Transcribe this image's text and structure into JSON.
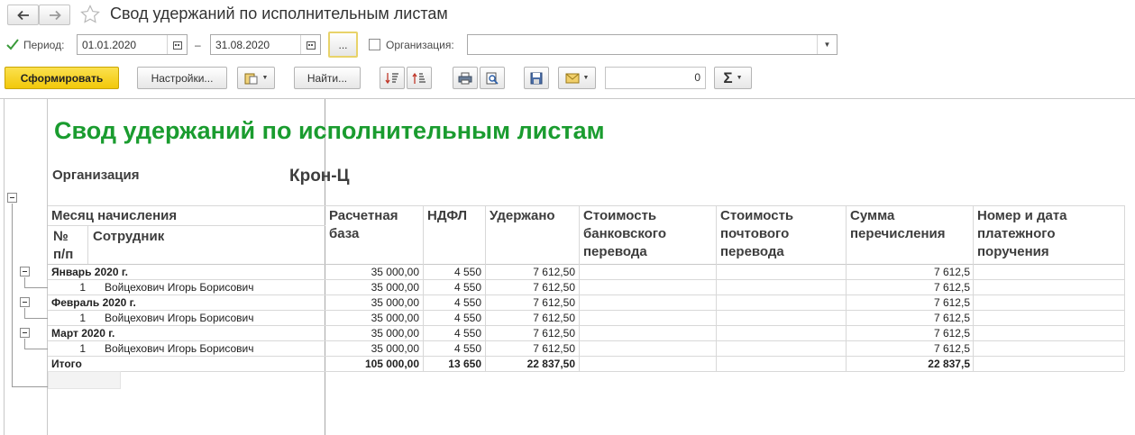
{
  "window": {
    "title": "Свод удержаний по исполнительным листам",
    "back_icon": "arrow-left-icon",
    "forward_icon": "arrow-right-icon",
    "favorite_icon": "star-icon"
  },
  "filters": {
    "period_label": "Период:",
    "date_from": "01.01.2020",
    "dash": "–",
    "date_to": "31.08.2020",
    "period_button": "...",
    "org_label": "Организация:",
    "org_value": ""
  },
  "toolbar": {
    "generate": "Сформировать",
    "settings": "Настройки...",
    "find": "Найти...",
    "sum_value": "0",
    "sigma": "Σ"
  },
  "report": {
    "title": "Свод удержаний по исполнительным листам",
    "org_label": "Организация",
    "org_value": "Крон-Ц",
    "headers": {
      "month": "Месяц начисления",
      "no_line1": "№",
      "no_line2": "п/п",
      "employee": "Сотрудник",
      "base_1": "Расчетная",
      "base_2": "база",
      "ndfl": "НДФЛ",
      "withheld": "Удержано",
      "bank_1": "Стоимость",
      "bank_2": "банковского",
      "bank_3": "перевода",
      "post_1": "Стоимость",
      "post_2": "почтового",
      "post_3": "перевода",
      "transfer_1": "Сумма",
      "transfer_2": "перечисления",
      "payment_1": "Номер и дата",
      "payment_2": "платежного",
      "payment_3": "поручения"
    },
    "rows": [
      {
        "label": "Январь 2020 г.",
        "no": "",
        "base": "35 000,00",
        "ndfl": "4 550",
        "withheld": "7 612,50",
        "transfer": "7 612,5"
      },
      {
        "label": "Войцехович Игорь Борисович",
        "no": "1",
        "base": "35 000,00",
        "ndfl": "4 550",
        "withheld": "7 612,50",
        "transfer": "7 612,5"
      },
      {
        "label": "Февраль 2020 г.",
        "no": "",
        "base": "35 000,00",
        "ndfl": "4 550",
        "withheld": "7 612,50",
        "transfer": "7 612,5"
      },
      {
        "label": "Войцехович Игорь Борисович",
        "no": "1",
        "base": "35 000,00",
        "ndfl": "4 550",
        "withheld": "7 612,50",
        "transfer": "7 612,5"
      },
      {
        "label": "Март 2020 г.",
        "no": "",
        "base": "35 000,00",
        "ndfl": "4 550",
        "withheld": "7 612,50",
        "transfer": "7 612,5"
      },
      {
        "label": "Войцехович Игорь Борисович",
        "no": "1",
        "base": "35 000,00",
        "ndfl": "4 550",
        "withheld": "7 612,50",
        "transfer": "7 612,5"
      }
    ],
    "total": {
      "label": "Итого",
      "base": "105 000,00",
      "ndfl": "13 650",
      "withheld": "22 837,50",
      "transfer": "22 837,5"
    }
  },
  "colors": {
    "title_green": "#1a9c2f",
    "generate_yellow": "#f5d316"
  }
}
